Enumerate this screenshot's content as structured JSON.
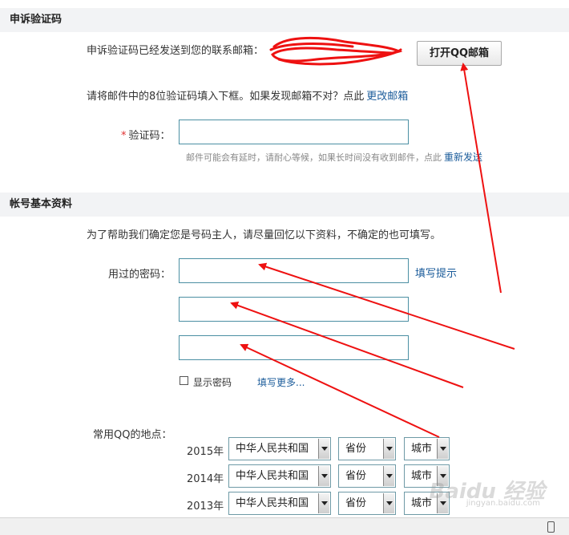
{
  "section_appeal": {
    "title": "申诉验证码",
    "sent_message": "申诉验证码已经发送到您的联系邮箱：",
    "open_mailbox_button": "打开QQ邮箱",
    "instruction": "请将邮件中的8位验证码填入下框。如果发现邮箱不对？点此",
    "change_email_link": "更改邮箱",
    "code_required_mark": "*",
    "code_label": "验证码：",
    "code_value": "",
    "delay_note": "邮件可能会有延时，请耐心等候，如果长时间没有收到邮件，点此",
    "resend_link": "重新发送"
  },
  "section_account": {
    "title": "帐号基本资料",
    "intro": "为了帮助我们确定您是号码主人，请尽量回忆以下资料，不确定的也可填写。",
    "password_label": "用过的密码：",
    "password_values": [
      "",
      "",
      ""
    ],
    "hint_link": "填写提示",
    "show_password_label": "显示密码",
    "more_link": "填写更多...",
    "location_label": "常用QQ的地点：",
    "location_rows": [
      {
        "year": "2015年",
        "country": "中华人民共和国",
        "province": "省份",
        "city": "城市"
      },
      {
        "year": "2014年",
        "country": "中华人民共和国",
        "province": "省份",
        "city": "城市"
      },
      {
        "year": "2013年",
        "country": "中华人民共和国",
        "province": "省份",
        "city": "城市"
      }
    ]
  },
  "watermark": {
    "text": "Baidu 经验",
    "sub": "jingyan.baidu.com"
  },
  "colors": {
    "header_bg": "#f2f3f5",
    "link": "#1a5b9a",
    "required": "#e03030",
    "annotation": "#ee1111",
    "input_border": "#4b8fa3"
  },
  "icons": {
    "arrow_annotation": "red-arrow-icon",
    "scribble": "red-scribble-redaction",
    "phone": "phone-icon"
  }
}
